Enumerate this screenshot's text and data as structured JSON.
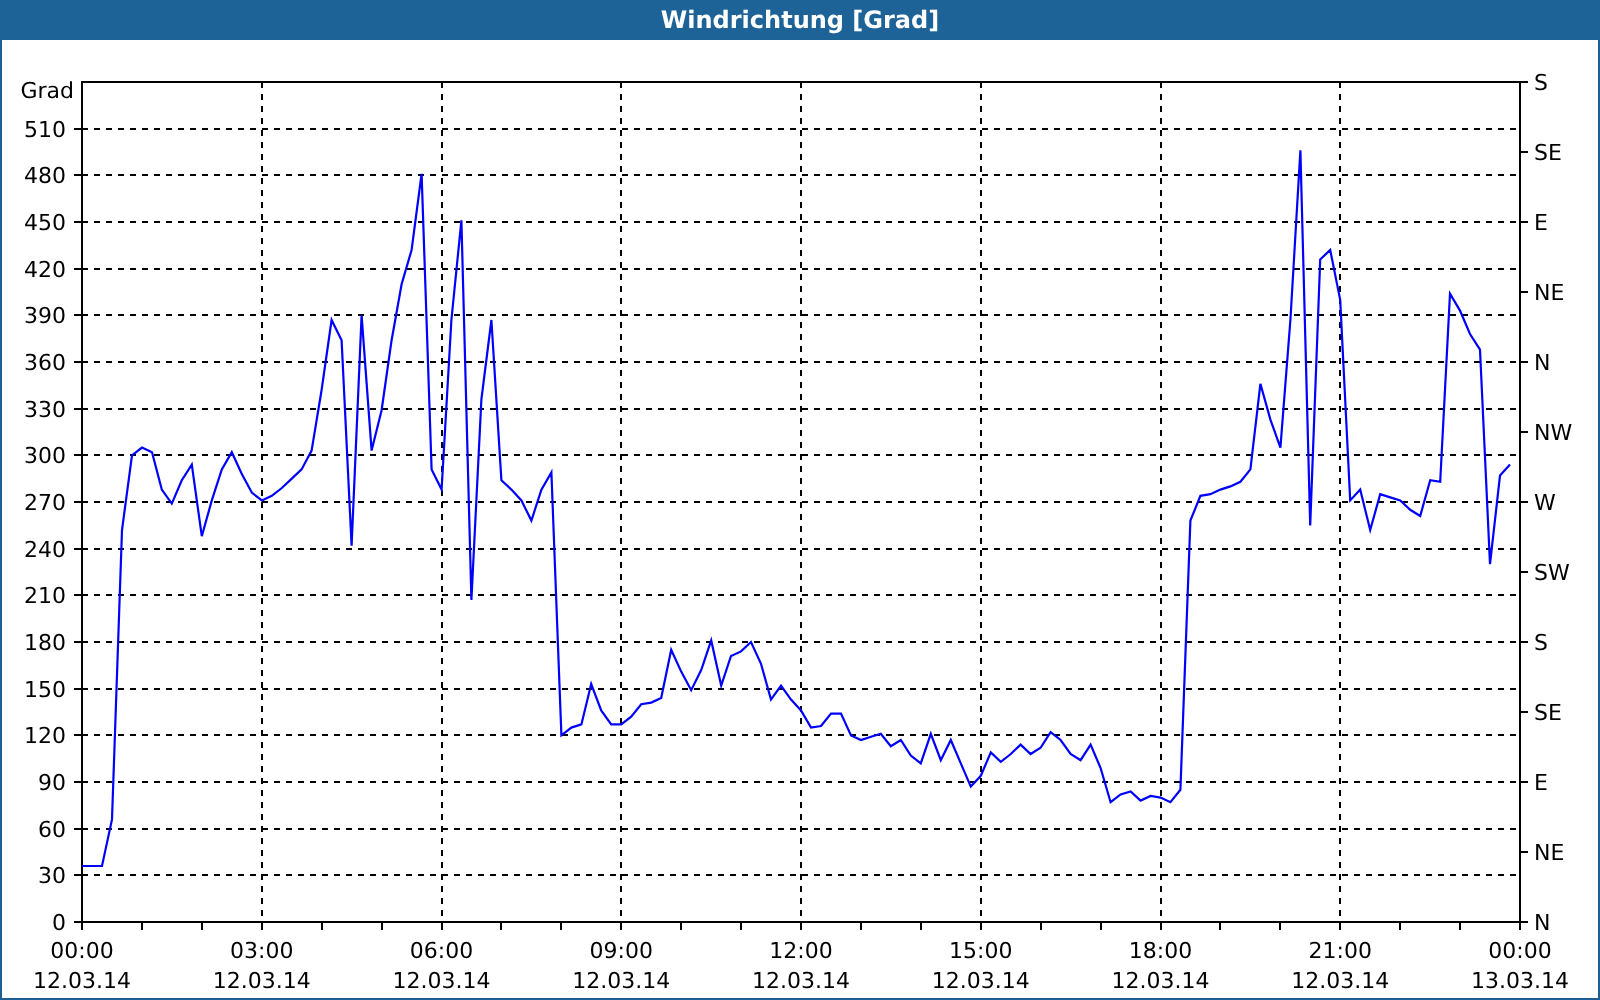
{
  "window": {
    "title": "Windrichtung [Grad]"
  },
  "chart_data": {
    "type": "line",
    "grid": true,
    "ylabel": "Grad",
    "ylim": [
      0,
      540
    ],
    "yticks": [
      0,
      30,
      60,
      90,
      120,
      150,
      180,
      210,
      240,
      270,
      300,
      330,
      360,
      390,
      420,
      450,
      480,
      510
    ],
    "categories": [
      "00:00\n12.03.14",
      null,
      null,
      null,
      null,
      null,
      null,
      null,
      null,
      null,
      null,
      null,
      null,
      null,
      null,
      null,
      null,
      null,
      "03:00\n12.03.14",
      null,
      null,
      null,
      null,
      null,
      null,
      null,
      null,
      null,
      null,
      null,
      null,
      null,
      null,
      null,
      null,
      null,
      "06:00\n12.03.14",
      null,
      null,
      null,
      null,
      null,
      null,
      null,
      null,
      null,
      null,
      null,
      null,
      null,
      null,
      null,
      null,
      null,
      "09:00\n12.03.14",
      null,
      null,
      null,
      null,
      null,
      null,
      null,
      null,
      null,
      null,
      null,
      null,
      null,
      null,
      null,
      null,
      null,
      "12:00\n12.03.14",
      null,
      null,
      null,
      null,
      null,
      null,
      null,
      null,
      null,
      null,
      null,
      null,
      null,
      null,
      null,
      null,
      null,
      "15:00\n12.03.14",
      null,
      null,
      null,
      null,
      null,
      null,
      null,
      null,
      null,
      null,
      null,
      null,
      null,
      null,
      null,
      null,
      null,
      "18:00\n12.03.14",
      null,
      null,
      null,
      null,
      null,
      null,
      null,
      null,
      null,
      null,
      null,
      null,
      null,
      null,
      null,
      null,
      null,
      "21:00\n12.03.14",
      null,
      null,
      null,
      null,
      null,
      null,
      null,
      null,
      null,
      null,
      null,
      null,
      null,
      null,
      null,
      null,
      null,
      "00:00\n13.03.14"
    ],
    "series": [
      {
        "color": "#0000ff",
        "values": [
          36,
          36,
          36,
          66,
          252,
          300,
          305,
          302,
          278,
          269,
          284,
          294,
          248,
          271,
          291,
          302,
          288,
          276,
          271,
          274,
          279,
          285,
          291,
          303,
          342,
          387,
          374,
          242,
          390,
          303,
          329,
          374,
          410,
          432,
          481,
          291,
          278,
          387,
          451,
          207,
          336,
          387,
          284,
          278,
          271,
          258,
          278,
          289,
          120,
          125,
          127,
          153,
          136,
          127,
          127,
          132,
          140,
          141,
          144,
          175,
          161,
          149,
          162,
          181,
          152,
          171,
          174,
          180,
          166,
          143,
          152,
          143,
          136,
          125,
          126,
          134,
          134,
          120,
          117,
          119,
          121,
          113,
          117,
          107,
          102,
          121,
          104,
          117,
          102,
          87,
          94,
          109,
          103,
          108,
          114,
          108,
          112,
          122,
          117,
          108,
          104,
          114,
          99,
          77,
          82,
          84,
          78,
          81,
          80,
          77,
          85,
          258,
          274,
          275,
          278,
          280,
          283,
          291,
          346,
          323,
          305,
          387,
          496,
          255,
          426,
          432,
          400,
          271,
          278,
          252,
          275,
          273,
          271,
          265,
          261,
          284,
          283,
          404,
          393,
          378,
          368,
          230,
          287,
          294,
          null
        ]
      }
    ]
  },
  "right_axis": {
    "labels": [
      "S",
      "SE",
      "E",
      "NE",
      "N",
      "NW",
      "W",
      "SW",
      "S",
      "SE",
      "E",
      "NE",
      "N"
    ]
  }
}
